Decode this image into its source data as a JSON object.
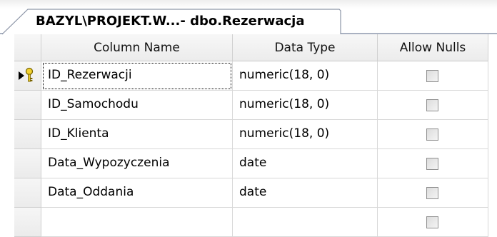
{
  "tab": {
    "title": "BAZYL\\PROJEKT.W...- dbo.Rezerwacja"
  },
  "columns": {
    "name": "Column Name",
    "type": "Data Type",
    "nulls": "Allow Nulls"
  },
  "rows": [
    {
      "name": "ID_Rezerwacji",
      "type": "numeric(18, 0)",
      "allow_nulls": false,
      "selected": true,
      "primary_key": true
    },
    {
      "name": "ID_Samochodu",
      "type": "numeric(18, 0)",
      "allow_nulls": false
    },
    {
      "name": "ID_Klienta",
      "type": "numeric(18, 0)",
      "allow_nulls": false
    },
    {
      "name": "Data_Wypozyczenia",
      "type": "date",
      "allow_nulls": false
    },
    {
      "name": "Data_Oddania",
      "type": "date",
      "allow_nulls": false
    },
    {
      "name": "",
      "type": "",
      "allow_nulls": false
    }
  ],
  "icons": {
    "row_indicator": "current-row-arrow-icon",
    "primary_key": "key-icon"
  }
}
